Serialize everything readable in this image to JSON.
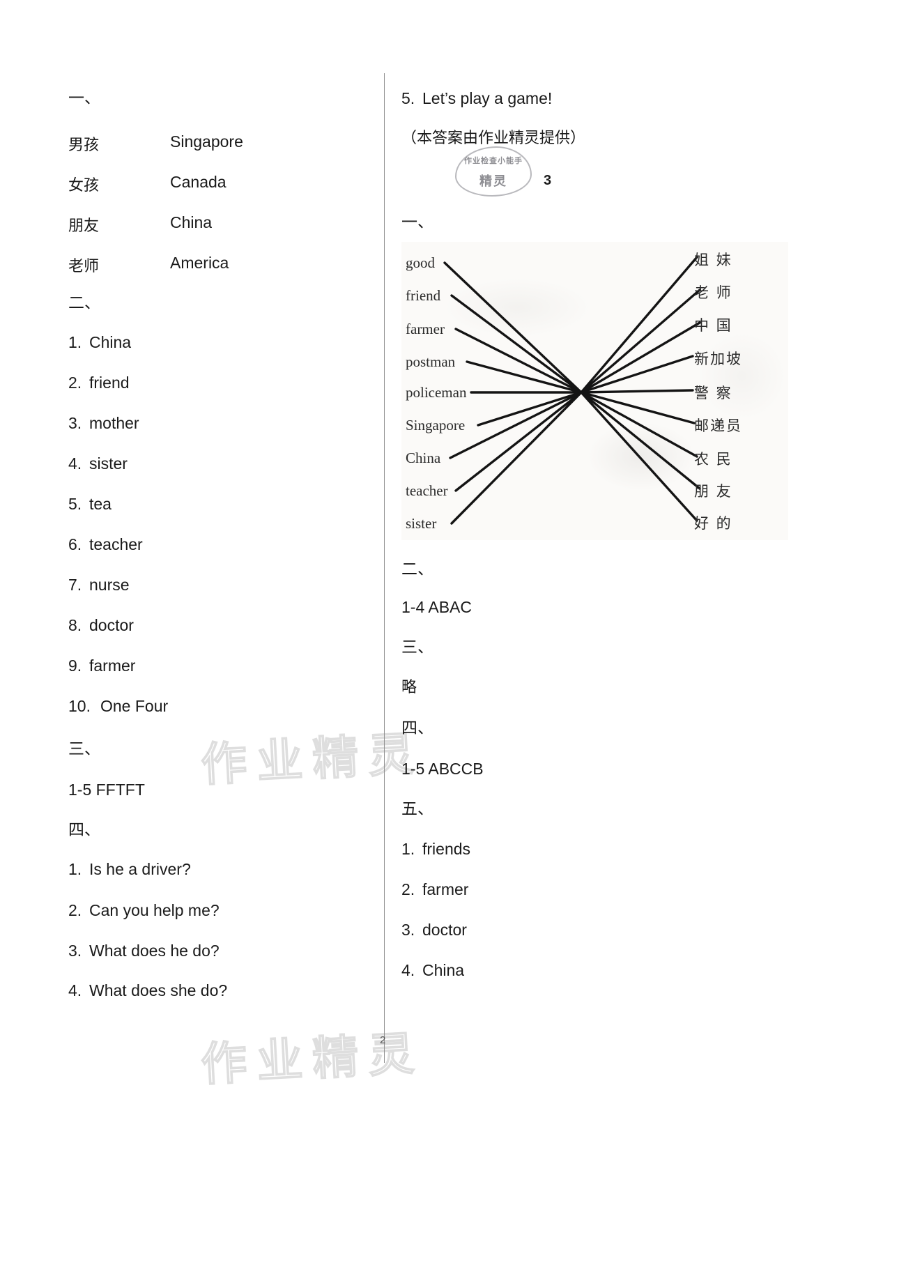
{
  "document": {
    "page_number_right": "3",
    "page_number_bottom": "2"
  },
  "watermark": {
    "text": "作业精灵"
  },
  "stamp": {
    "top_text": "作业检查小能手",
    "bottom_text": "精灵"
  },
  "left_column": {
    "section_1": {
      "heading": "一、",
      "pairs": [
        {
          "cn": "男孩",
          "en": "Singapore"
        },
        {
          "cn": "女孩",
          "en": "Canada"
        },
        {
          "cn": "朋友",
          "en": "China"
        },
        {
          "cn": "老师",
          "en": "America"
        }
      ]
    },
    "section_2": {
      "heading": "二、",
      "items": [
        {
          "num": "1.",
          "text": "China"
        },
        {
          "num": "2.",
          "text": "friend"
        },
        {
          "num": "3.",
          "text": "mother"
        },
        {
          "num": "4.",
          "text": "sister"
        },
        {
          "num": "5.",
          "text": "tea"
        },
        {
          "num": "6.",
          "text": "teacher"
        },
        {
          "num": "7.",
          "text": "nurse"
        },
        {
          "num": "8.",
          "text": "doctor"
        },
        {
          "num": "9.",
          "text": "farmer"
        },
        {
          "num": "10.",
          "text": "One Four"
        }
      ]
    },
    "section_3": {
      "heading": "三、",
      "answer": "1-5 FFTFT"
    },
    "section_4": {
      "heading": "四、",
      "items": [
        {
          "num": "1.",
          "text": "Is he a driver?"
        },
        {
          "num": "2.",
          "text": "Can you help me?"
        },
        {
          "num": "3.",
          "text": "What does he do?"
        },
        {
          "num": "4.",
          "text": "What does she do?"
        }
      ]
    }
  },
  "right_column": {
    "carryover": {
      "num": "5.",
      "text": "Let’s play a game!"
    },
    "credit": "（本答案由作业精灵提供）",
    "section_1": {
      "heading": "一、",
      "matching": {
        "left_words": [
          "good",
          "friend",
          "farmer",
          "postman",
          "policeman",
          "Singapore",
          "China",
          "teacher",
          "sister"
        ],
        "right_words": [
          "姐 妹",
          "老 师",
          "中 国",
          "新加坡",
          "警 察",
          "邮递员",
          "农 民",
          "朋 友",
          "好 的"
        ]
      }
    },
    "section_2": {
      "heading": "二、",
      "answer": "1-4 ABAC"
    },
    "section_3": {
      "heading": "三、",
      "answer": "略"
    },
    "section_4": {
      "heading": "四、",
      "answer": "1-5 ABCCB"
    },
    "section_5": {
      "heading": "五、",
      "items": [
        {
          "num": "1.",
          "text": "friends"
        },
        {
          "num": "2.",
          "text": "farmer"
        },
        {
          "num": "3.",
          "text": "doctor"
        },
        {
          "num": "4.",
          "text": "China"
        }
      ]
    }
  }
}
